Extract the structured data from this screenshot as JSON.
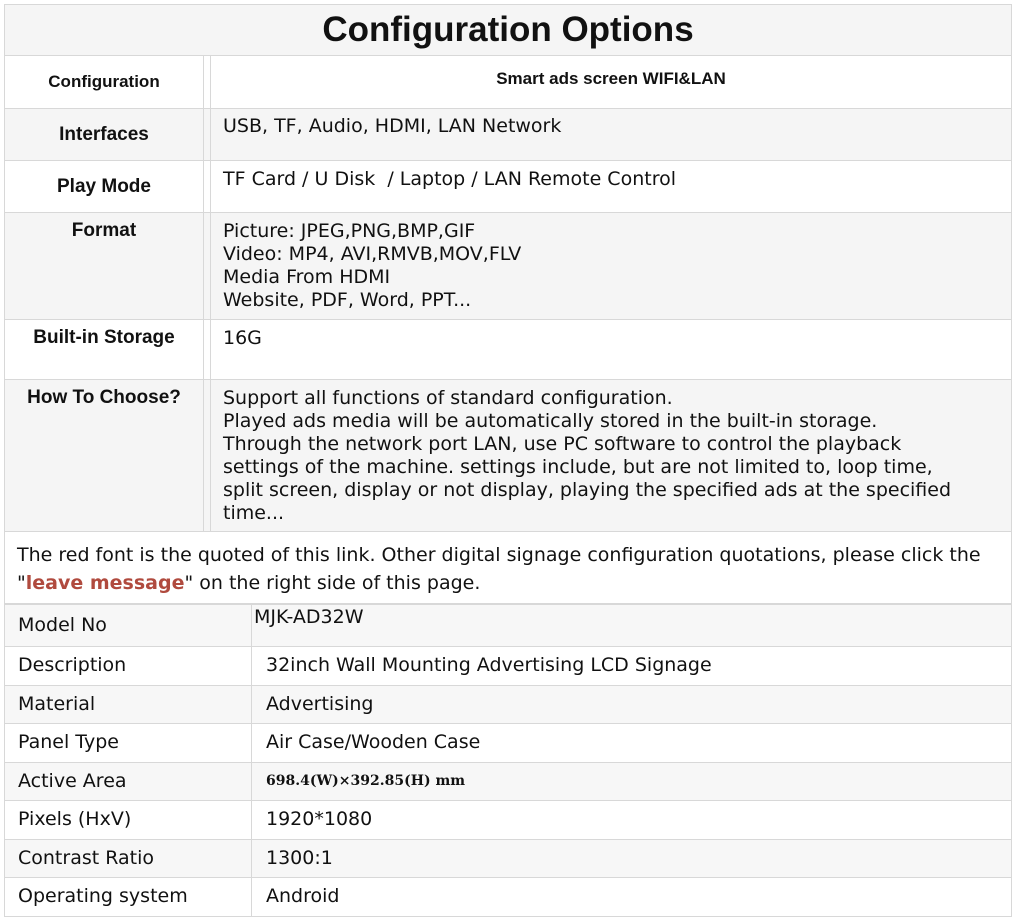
{
  "title": "Configuration Options",
  "config": {
    "header": {
      "key": "Configuration",
      "value": "Smart ads screen WIFI&LAN"
    },
    "rows": [
      {
        "key": "Interfaces",
        "lines": [
          "USB, TF, Audio, HDMI, LAN Network"
        ]
      },
      {
        "key": "Play Mode",
        "lines": [
          "TF Card / U Disk  / Laptop / LAN Remote Control"
        ]
      },
      {
        "key": "Format",
        "lines": [
          "Picture: JPEG,PNG,BMP,GIF",
          "Video: MP4, AVI,RMVB,MOV,FLV",
          "Media From HDMI",
          "Website, PDF, Word, PPT..."
        ]
      },
      {
        "key": "Built-in Storage",
        "lines": [
          "16G"
        ]
      },
      {
        "key": "How To Choose?",
        "lines": [
          "Support all functions of standard configuration.",
          "Played ads media will be automatically stored in the built-in storage.",
          "Through the network port LAN, use PC software to control the playback",
          "settings of the machine. settings include, but are not limited to, loop time,",
          "split screen, display or not display, playing the specified ads at the specified",
          "time..."
        ]
      }
    ]
  },
  "note": {
    "text1": "The red font is the quoted of this link. Other digital signage configuration quotations, please click the",
    "quote_open": "\"",
    "link": "leave message",
    "text2": "\" on the right side of this page."
  },
  "specs": [
    {
      "key": "Model No",
      "value": "MJK-AD32W"
    },
    {
      "key": "Description",
      "value": "32inch Wall Mounting Advertising LCD Signage"
    },
    {
      "key": "Material",
      "value": "Advertising"
    },
    {
      "key": "Panel Type",
      "value": "Air Case/Wooden Case"
    },
    {
      "key": "Active Area",
      "value": "698.4(W)×392.85(H) mm"
    },
    {
      "key": "Pixels (HxV)",
      "value": "1920*1080"
    },
    {
      "key": "Contrast Ratio",
      "value": "1300:1"
    },
    {
      "key": "Operating system",
      "value": "Android"
    }
  ]
}
